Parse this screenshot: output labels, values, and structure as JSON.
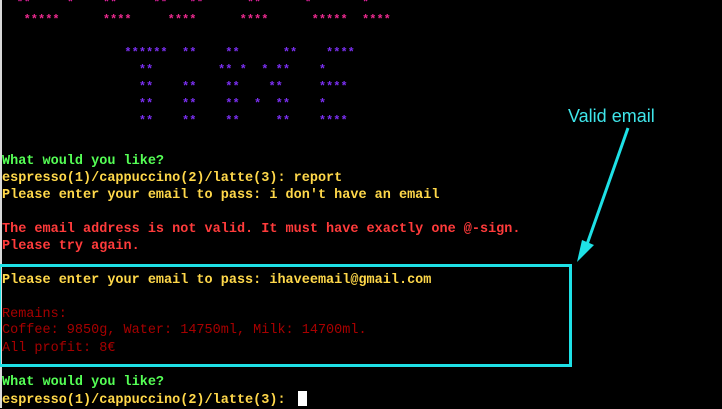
{
  "ascii_art": {
    "row0": "  **     *    **     **   **      **      *       *",
    "row1": "   *****      ****     ****      ****      *****  ****",
    "row2": "",
    "row3": "                 ******  **    **      **    ****",
    "row4": "                   **         ** *  * **    *",
    "row5": "                   **    **    **    **     ****",
    "row6": "                   **    **    **  *  **    *",
    "row7": "                   **    **    **     **    ****"
  },
  "terminal": {
    "line1": "What would you like?",
    "line2": "espresso(1)/cappuccino(2)/latte(3): report",
    "line3": "Please enter your email to pass: i don't have an email",
    "line4": "The email address is not valid. It must have exactly one @-sign.",
    "line5": "Please try again.",
    "line6": "Please enter your email to pass: ihaveemail@gmail.com",
    "line7": "Remains:",
    "line8": "Coffee: 9850g, Water: 14750ml, Milk: 14700ml.",
    "line9": "All profit: 8€",
    "line10": "What would you like?",
    "line11": "espresso(1)/cappuccino(2)/latte(3): "
  },
  "annotation": {
    "label": "Valid email",
    "color": "#1ee1e6"
  }
}
